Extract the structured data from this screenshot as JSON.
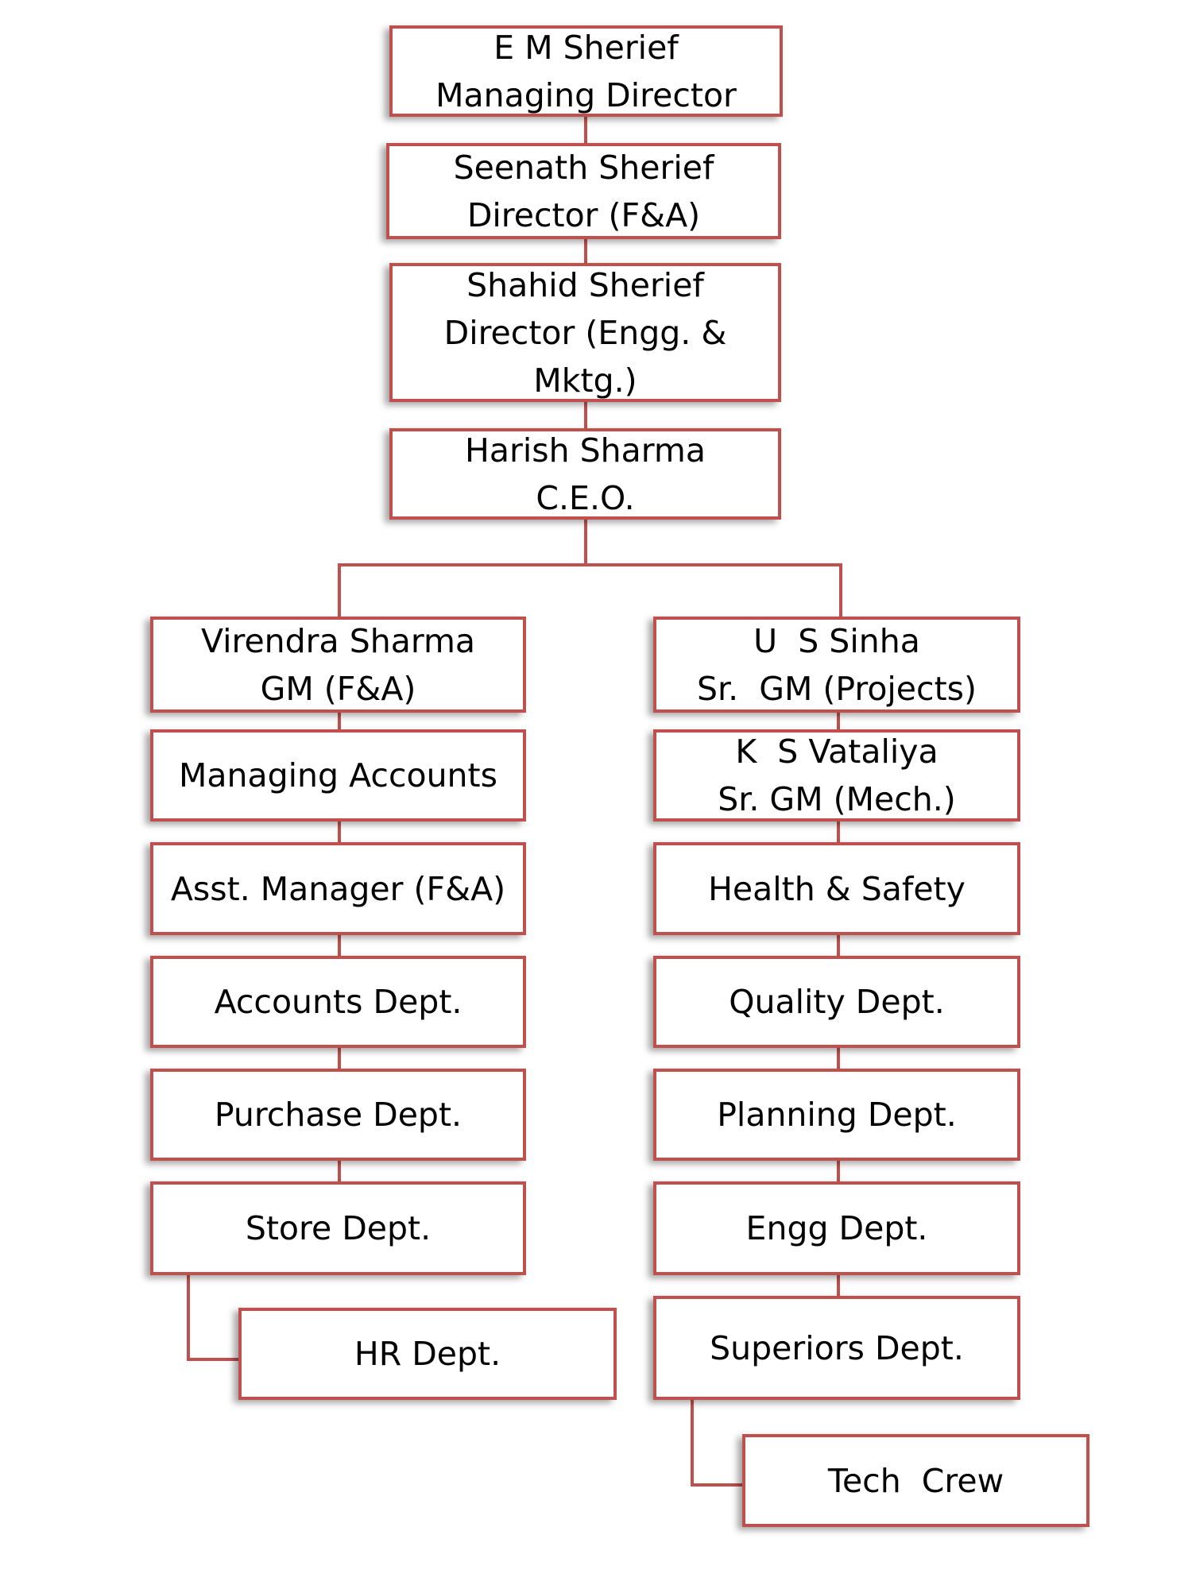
{
  "colors": {
    "border": "#c0504d",
    "connector": "#c0504d",
    "background": "#ffffff"
  },
  "top_chain": [
    {
      "lines": [
        "E M Sherief",
        "Managing Director"
      ]
    },
    {
      "lines": [
        "Seenath Sherief",
        "Director (F&A)"
      ]
    },
    {
      "lines": [
        "Shahid Sherief",
        "Director (Engg. &",
        "Mktg.)"
      ]
    },
    {
      "lines": [
        "Harish Sharma",
        "C.E.O."
      ]
    }
  ],
  "left_column": [
    {
      "lines": [
        "Virendra Sharma",
        "GM (F&A)"
      ]
    },
    {
      "lines": [
        "Managing Accounts"
      ]
    },
    {
      "lines": [
        "Asst. Manager (F&A)"
      ]
    },
    {
      "lines": [
        "Accounts Dept."
      ]
    },
    {
      "lines": [
        "Purchase Dept."
      ]
    },
    {
      "lines": [
        "Store Dept."
      ]
    },
    {
      "lines": [
        "HR Dept."
      ]
    }
  ],
  "right_column": [
    {
      "lines": [
        "U  S Sinha",
        "Sr.  GM (Projects)"
      ]
    },
    {
      "lines": [
        "K  S Vataliya",
        "Sr. GM (Mech.)"
      ]
    },
    {
      "lines": [
        "Health & Safety"
      ]
    },
    {
      "lines": [
        "Quality Dept."
      ]
    },
    {
      "lines": [
        "Planning Dept."
      ]
    },
    {
      "lines": [
        "Engg Dept."
      ]
    },
    {
      "lines": [
        "Superiors Dept."
      ]
    },
    {
      "lines": [
        "Tech  Crew"
      ]
    }
  ]
}
